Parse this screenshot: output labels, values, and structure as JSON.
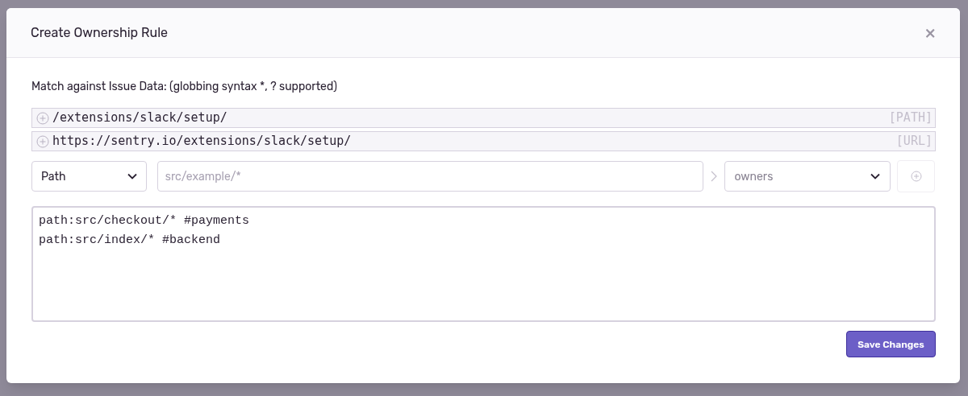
{
  "modal": {
    "title": "Create Ownership Rule",
    "close": "×"
  },
  "hint": "Match against Issue Data: (globbing syntax *, ? supported)",
  "suggestions": [
    {
      "value": "/extensions/slack/setup/",
      "type": "[PATH]"
    },
    {
      "value": "https://sentry.io/extensions/slack/setup/",
      "type": "[URL]"
    }
  ],
  "rule_builder": {
    "type_select": {
      "value": "Path"
    },
    "pattern_field": {
      "placeholder": "src/example/*"
    },
    "owner_select": {
      "placeholder": "owners"
    },
    "add_button": {
      "disabled": true
    }
  },
  "rules_text": "path:src/checkout/* #payments\npath:src/index/* #backend",
  "save_button": {
    "label": "Save Changes"
  }
}
